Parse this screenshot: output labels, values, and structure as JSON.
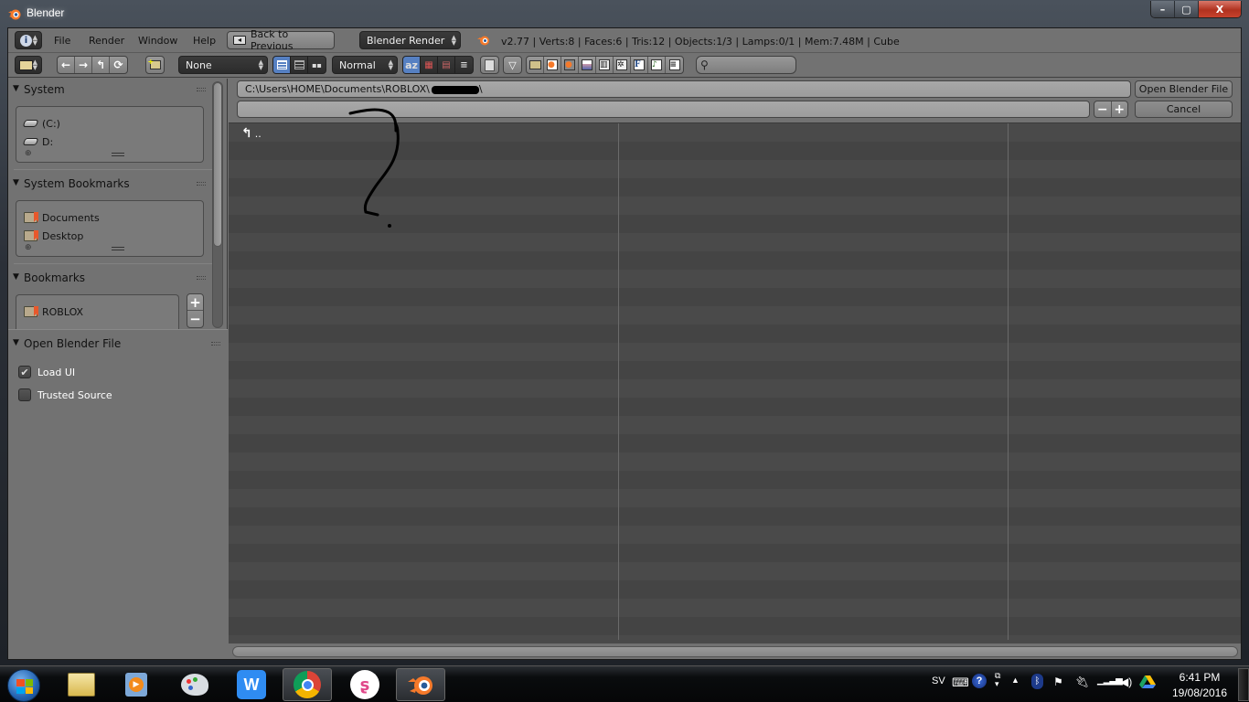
{
  "window": {
    "title": "Blender",
    "controls": {
      "minimize": "–",
      "maximize": "▢",
      "close": "X"
    }
  },
  "info_header": {
    "menu": [
      "File",
      "Render",
      "Window",
      "Help"
    ],
    "back_button": "Back to Previous",
    "render_engine": "Blender Render",
    "stats": "v2.77 | Verts:8 | Faces:6 | Tris:12 | Objects:1/3 | Lamps:0/1 | Mem:7.48M | Cube"
  },
  "file_header": {
    "nav_icons": [
      "back-arrow-icon",
      "forward-arrow-icon",
      "parent-dir-icon",
      "refresh-icon"
    ],
    "new_folder_icon": "new-folder-icon",
    "recursion_select": "None",
    "display_modes": [
      "short-list-icon",
      "long-list-icon",
      "thumbnails-icon"
    ],
    "display_size": "Normal",
    "sort_icons": [
      "sort-alpha-icon",
      "sort-extension-icon",
      "sort-time-icon",
      "sort-size-icon"
    ],
    "filter_icons": [
      "folder-filter-icon",
      "blend-filter-icon",
      "blend-backup-filter-icon",
      "image-filter-icon",
      "movie-filter-icon",
      "script-filter-icon",
      "font-filter-icon",
      "sound-filter-icon",
      "text-filter-icon"
    ],
    "search_placeholder": ""
  },
  "sidebar": {
    "system": {
      "title": "System",
      "items": [
        "(C:)",
        "D:"
      ]
    },
    "system_bookmarks": {
      "title": "System Bookmarks",
      "items": [
        "Documents",
        "Desktop"
      ]
    },
    "bookmarks": {
      "title": "Bookmarks",
      "items": [
        "ROBLOX"
      ]
    },
    "operator": {
      "title": "Open Blender File",
      "options": [
        {
          "label": "Load UI",
          "checked": true
        },
        {
          "label": "Trusted Source",
          "checked": false
        }
      ]
    }
  },
  "main": {
    "path": "C:\\Users\\HOME\\Documents\\ROBLOX\\",
    "path_suffix": "\\",
    "filename": "",
    "open_button": "Open Blender File",
    "cancel_button": "Cancel",
    "parent_entry": ".."
  },
  "taskbar": {
    "apps": [
      "Windows Explorer",
      "Windows Media Player",
      "Paint",
      "WPS Writer",
      "Google Chrome",
      "App",
      "Blender"
    ],
    "language": "SV",
    "time": "6:41 PM",
    "date": "19/08/2016"
  }
}
